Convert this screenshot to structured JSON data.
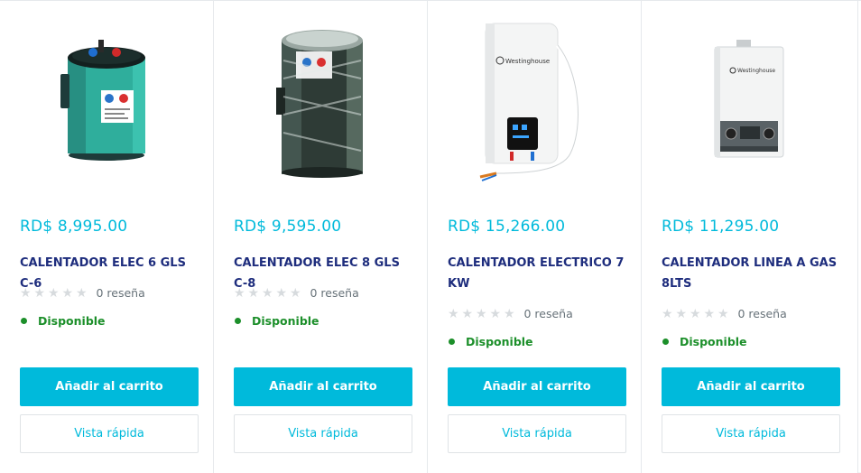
{
  "products": [
    {
      "price": "RD$ 8,995.00",
      "title": "CALENTADOR ELEC 6 GLS C-6",
      "image_icon": "water-heater-teal-icon",
      "rating_text": "0 reseña",
      "stock": "Disponible",
      "add_to_cart": "Añadir al carrito",
      "quick_view": "Vista rápida"
    },
    {
      "price": "RD$ 9,595.00",
      "title": "CALENTADOR ELEC 8 GLS C-8",
      "image_icon": "water-heater-wrapped-icon",
      "rating_text": "0 reseña",
      "stock": "Disponible",
      "add_to_cart": "Añadir al carrito",
      "quick_view": "Vista rápida"
    },
    {
      "price": "RD$ 15,266.00",
      "title": "CALENTADOR ELECTRICO 7 KW",
      "image_icon": "electric-heater-white-icon",
      "rating_text": "0 reseña",
      "stock": "Disponible",
      "add_to_cart": "Añadir al carrito",
      "quick_view": "Vista rápida"
    },
    {
      "price": "RD$ 11,295.00",
      "title": "CALENTADOR LINEA A GAS 8LTS",
      "image_icon": "gas-heater-icon",
      "rating_text": "0 reseña",
      "stock": "Disponible",
      "add_to_cart": "Añadir al carrito",
      "quick_view": "Vista rápida"
    }
  ],
  "brand_label": "Westinghouse",
  "colors": {
    "accent": "#00badb",
    "title": "#1e2d7d",
    "in_stock": "#1c8f2a",
    "star_empty": "#d7dbde"
  }
}
